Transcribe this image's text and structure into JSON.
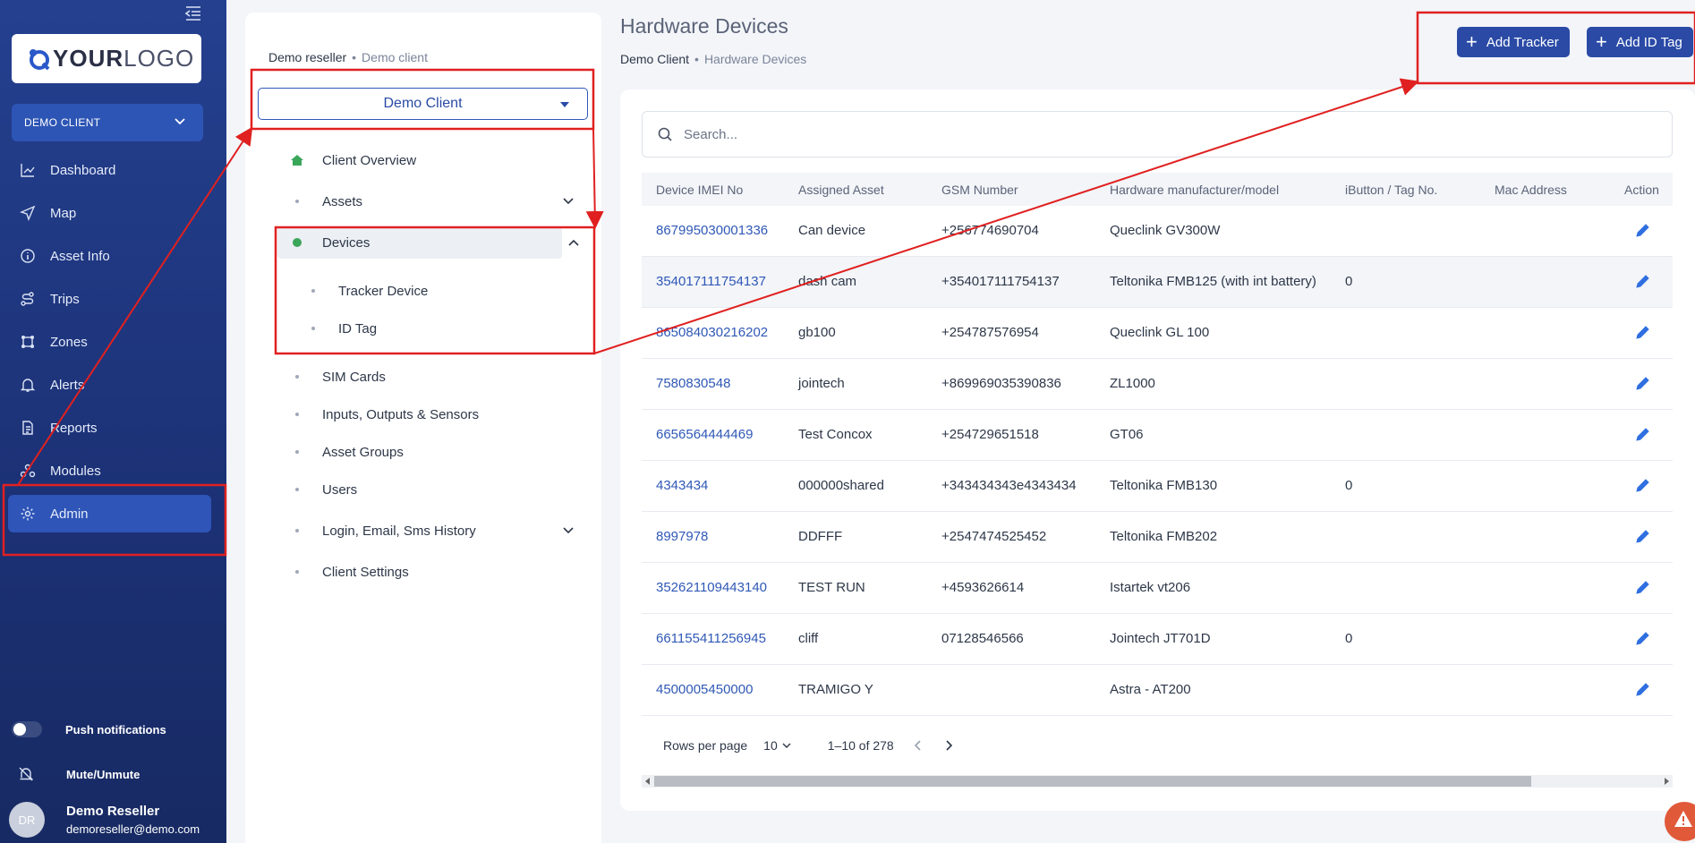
{
  "logo": {
    "bold": "YOUR",
    "light": "LOGO"
  },
  "sidebar": {
    "client_label": "DEMO CLIENT",
    "items": [
      {
        "label": "Dashboard",
        "icon": "chart-line-icon"
      },
      {
        "label": "Map",
        "icon": "navigation-icon"
      },
      {
        "label": "Asset Info",
        "icon": "info-icon"
      },
      {
        "label": "Trips",
        "icon": "route-icon"
      },
      {
        "label": "Zones",
        "icon": "zones-icon"
      },
      {
        "label": "Alerts",
        "icon": "bell-icon"
      },
      {
        "label": "Reports",
        "icon": "document-icon"
      },
      {
        "label": "Modules",
        "icon": "modules-icon"
      },
      {
        "label": "Admin",
        "icon": "gear-icon"
      }
    ],
    "push_label": "Push notifications",
    "mute_label": "Mute/Unmute",
    "user": {
      "initials": "DR",
      "name": "Demo Reseller",
      "email": "demoreseller@demo.com"
    }
  },
  "admin_panel": {
    "breadcrumb": {
      "root": "Demo reseller",
      "current": "Demo client"
    },
    "client_select": "Demo Client",
    "menu": {
      "client_overview": "Client Overview",
      "assets": "Assets",
      "devices": "Devices",
      "tracker_device": "Tracker Device",
      "id_tag": "ID Tag",
      "sim_cards": "SIM Cards",
      "inputs": "Inputs, Outputs & Sensors",
      "asset_groups": "Asset Groups",
      "users": "Users",
      "login_history": "Login, Email, Sms History",
      "client_settings": "Client Settings"
    }
  },
  "main": {
    "title": "Hardware Devices",
    "breadcrumb": {
      "root": "Demo Client",
      "current": "Hardware Devices"
    },
    "add_tracker": "Add Tracker",
    "add_id_tag": "Add ID Tag",
    "search_placeholder": "Search...",
    "columns": [
      "Device IMEI No",
      "Assigned Asset",
      "GSM Number",
      "Hardware manufacturer/model",
      "iButton / Tag No.",
      "Mac Address",
      "Action"
    ],
    "rows": [
      [
        "867995030001336",
        "Can device",
        "+256774690704",
        "Queclink GV300W",
        "",
        ""
      ],
      [
        "354017111754137",
        "dash cam",
        "+354017111754137",
        "Teltonika FMB125 (with int battery)",
        "0",
        ""
      ],
      [
        "865084030216202",
        "gb100",
        "+254787576954",
        "Queclink GL 100",
        "",
        ""
      ],
      [
        "7580830548",
        "jointech",
        "+869969035390836",
        "ZL1000",
        "",
        ""
      ],
      [
        "6656564444469",
        "Test Concox",
        "+254729651518",
        "GT06",
        "",
        ""
      ],
      [
        "4343434",
        "000000shared",
        "+343434343e4343434",
        "Teltonika FMB130",
        "0",
        ""
      ],
      [
        "8997978",
        "DDFFF",
        "+2547474525452",
        "Teltonika FMB202",
        "",
        ""
      ],
      [
        "352621109443140",
        "TEST RUN",
        "+4593626614",
        "Istartek vt206",
        "",
        ""
      ],
      [
        "661155411256945",
        "cliff",
        "07128546566",
        "Jointech JT701D",
        "0",
        ""
      ],
      [
        "4500005450000",
        "TRAMIGO Y",
        "",
        "Astra - AT200",
        "",
        ""
      ]
    ],
    "pager": {
      "rows_label": "Rows per page",
      "rows_value": "10",
      "range": "1–10 of 278"
    }
  },
  "colors": {
    "primary": "#2a4aa6",
    "sidebar": "#1c3175",
    "annotation": "#e02020"
  }
}
